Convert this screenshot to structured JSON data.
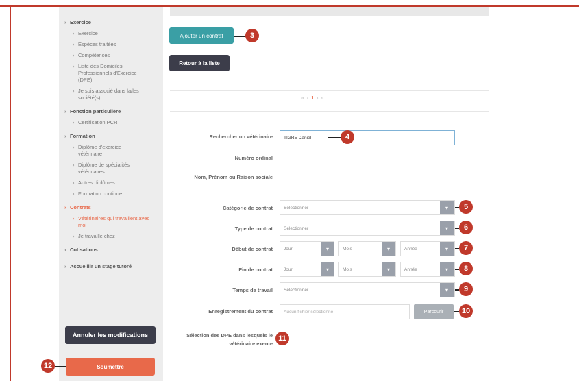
{
  "sidebar": {
    "sections": [
      {
        "label": "Exercice",
        "items": [
          "Exercice",
          "Espèces traitées",
          "Compétences",
          "Liste des Domiciles Professionnels d'Exercice (DPE)",
          "Je suis associé dans la/les société(s)"
        ]
      },
      {
        "label": "Fonction particulière",
        "items": [
          "Certification PCR"
        ]
      },
      {
        "label": "Formation",
        "items": [
          "Diplôme d'exercice vétérinaire",
          "Diplôme de spécialités vétérinaires",
          "Autres diplômes",
          "Formation continue"
        ]
      },
      {
        "label": "Contrats",
        "items": [
          "Vétérinaires qui travaillent avec moi",
          "Je travaille chez"
        ]
      },
      {
        "label": "Cotisations",
        "items": []
      },
      {
        "label": "Accueillir un stage tutoré",
        "items": []
      }
    ],
    "annuler_label": "Annuler les modifications",
    "soumettre_label": "Soumettre"
  },
  "main": {
    "ajouter_label": "Ajouter un contrat",
    "retour_label": "Retour à la liste",
    "pager": {
      "prev_first": "«",
      "prev": "‹",
      "current": "1",
      "next": "›",
      "next_last": "»"
    },
    "form": {
      "rechercher_label": "Rechercher un vétérinaire",
      "rechercher_value": "TIGRE Daniel",
      "numero_label": "Numéro ordinal",
      "nom_label": "Nom, Prénom ou Raison sociale",
      "categorie_label": "Catégorie de contrat",
      "categorie_value": "Sélectionner",
      "type_label": "Type de contrat",
      "type_value": "Sélectionner",
      "debut_label": "Début de contrat",
      "fin_label": "Fin de contrat",
      "jour": "Jour",
      "mois": "Mois",
      "annee": "Année",
      "temps_label": "Temps de travail",
      "temps_value": "Sélectionner",
      "enregistrement_label": "Enregistrement du contrat",
      "fichier_placeholder": "Aucun fichier sélectionné",
      "parcourir_label": "Parcourir",
      "selection_dpe_label": "Sélection des DPE dans lesquels le vétérinaire exerce"
    }
  },
  "callouts": [
    "3",
    "4",
    "5",
    "6",
    "7",
    "8",
    "9",
    "10",
    "11",
    "12"
  ],
  "colors": {
    "accent_red": "#c0392b",
    "orange": "#e8694a",
    "teal": "#3a9fa5",
    "dark": "#3c3d4a"
  }
}
